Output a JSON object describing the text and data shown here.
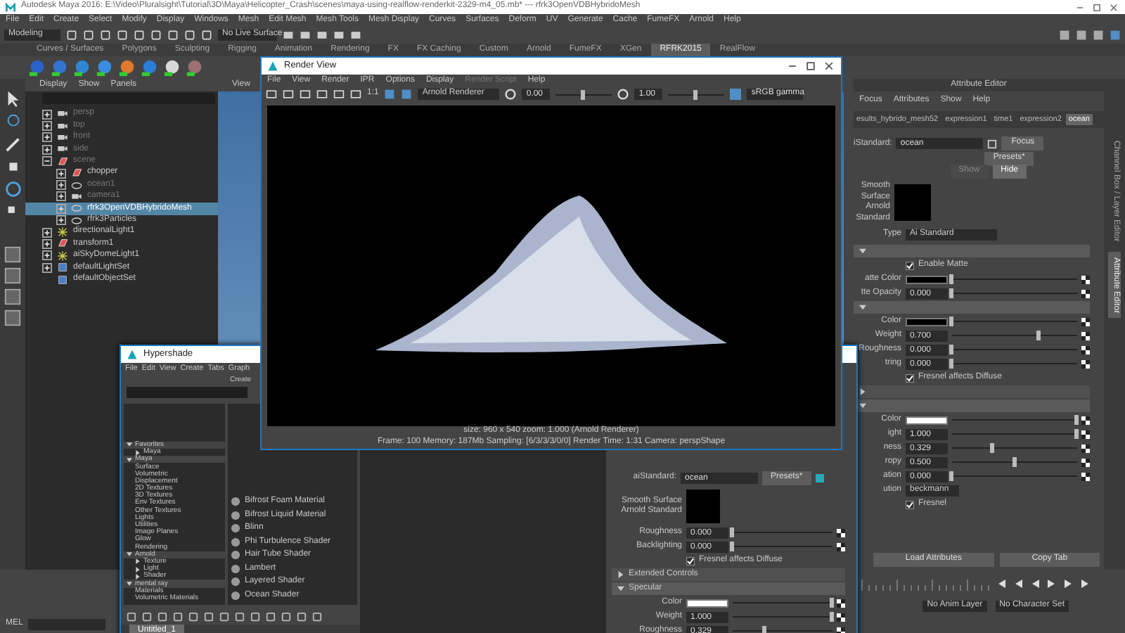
{
  "window": {
    "title": "Autodesk Maya 2016: E:\\Video\\Pluralsight\\Tutorial\\3D\\Maya\\Helicopter_Crash\\scenes\\maya-using-realflow-renderkit-2329-m4_05.mb*  ---  rfrk3OpenVDBHybridoMesh"
  },
  "menubar": [
    "File",
    "Edit",
    "Create",
    "Select",
    "Modify",
    "Display",
    "Windows",
    "Mesh",
    "Edit Mesh",
    "Mesh Tools",
    "Mesh Display",
    "Curves",
    "Surfaces",
    "Deform",
    "UV",
    "Generate",
    "Cache",
    "FumeFX",
    "Arnold",
    "Help"
  ],
  "status_line": {
    "mode": "Modeling",
    "live_surface": "No Live Surface"
  },
  "shelf_tabs": [
    {
      "label": "Curves / Surfaces",
      "selected": false
    },
    {
      "label": "Polygons",
      "selected": false
    },
    {
      "label": "Sculpting",
      "selected": false
    },
    {
      "label": "Rigging",
      "selected": false
    },
    {
      "label": "Animation",
      "selected": false
    },
    {
      "label": "Rendering",
      "selected": false
    },
    {
      "label": "FX",
      "selected": false
    },
    {
      "label": "FX Caching",
      "selected": false
    },
    {
      "label": "Custom",
      "selected": false
    },
    {
      "label": "Arnold",
      "selected": false
    },
    {
      "label": "FumeFX",
      "selected": false
    },
    {
      "label": "XGen",
      "selected": false
    },
    {
      "label": "RFRK2015",
      "selected": true
    },
    {
      "label": "RealFlow",
      "selected": false
    }
  ],
  "outliner": {
    "menu": [
      "Display",
      "Show",
      "Panels"
    ],
    "items": [
      {
        "label": "persp",
        "kind": "camera",
        "hidden": true,
        "selected": false,
        "expanded": false
      },
      {
        "label": "top",
        "kind": "camera",
        "hidden": true,
        "selected": false,
        "expanded": false
      },
      {
        "label": "front",
        "kind": "camera",
        "hidden": true,
        "selected": false,
        "expanded": false
      },
      {
        "label": "side",
        "kind": "camera",
        "hidden": true,
        "selected": false,
        "expanded": false
      },
      {
        "label": "scene",
        "kind": "group",
        "hidden": true,
        "selected": false,
        "expanded": true,
        "children": [
          {
            "label": "chopper",
            "kind": "group",
            "hidden": false,
            "selected": false,
            "expanded": false
          },
          {
            "label": "ocean1",
            "kind": "mesh",
            "hidden": true,
            "selected": false,
            "expanded": false
          },
          {
            "label": "camera1",
            "kind": "camera",
            "hidden": true,
            "selected": false,
            "expanded": false
          },
          {
            "label": "rfrk3OpenVDBHybridoMesh",
            "kind": "mesh",
            "hidden": false,
            "selected": true,
            "expanded": false
          },
          {
            "label": "rfrk3Particles",
            "kind": "mesh",
            "hidden": false,
            "selected": false,
            "expanded": false
          }
        ]
      },
      {
        "label": "directionalLight1",
        "kind": "light",
        "hidden": false,
        "selected": false,
        "expanded": false
      },
      {
        "label": "transform1",
        "kind": "group",
        "hidden": false,
        "selected": false,
        "expanded": false
      },
      {
        "label": "aiSkyDomeLight1",
        "kind": "light",
        "hidden": false,
        "selected": false,
        "expanded": false
      },
      {
        "label": "defaultLightSet",
        "kind": "set",
        "hidden": false,
        "selected": false,
        "expanded": false
      },
      {
        "label": "defaultObjectSet",
        "kind": "set",
        "hidden": false,
        "selected": false
      }
    ]
  },
  "viewport": {
    "menu": [
      "View"
    ]
  },
  "render_view": {
    "title": "Render View",
    "menu": [
      {
        "label": "File",
        "disabled": false
      },
      {
        "label": "View",
        "disabled": false
      },
      {
        "label": "Render",
        "disabled": false
      },
      {
        "label": "IPR",
        "disabled": false
      },
      {
        "label": "Options",
        "disabled": false
      },
      {
        "label": "Display",
        "disabled": false
      },
      {
        "label": "Render Script",
        "disabled": true
      },
      {
        "label": "Help",
        "disabled": false
      }
    ],
    "ratio": "1:1",
    "renderer": "Arnold Renderer",
    "exposure": {
      "value": "0.00",
      "level": 0.5
    },
    "gamma": {
      "value": "1.00",
      "level": 0.5
    },
    "color_space": "sRGB gamma",
    "info": "size: 960 x 540 zoom: 1.000     (Arnold Renderer)",
    "stats": "Frame: 100    Memory: 187Mb    Sampling: [6/3/3/3/0/0]    Render Time: 1:31    Camera: perspShape"
  },
  "hypershade": {
    "title": "Hypershade",
    "menu": [
      "File",
      "Edit",
      "View",
      "Create",
      "Tabs",
      "Graph"
    ],
    "browser_title": "Create",
    "categories": [
      {
        "label": "Favorites",
        "expanded": true,
        "children": [
          {
            "label": "Maya",
            "expanded": false
          }
        ]
      },
      {
        "label": "Maya",
        "expanded": true,
        "children": [
          {
            "label": "Surface"
          },
          {
            "label": "Volumetric"
          },
          {
            "label": "Displacement"
          },
          {
            "label": "2D Textures"
          },
          {
            "label": "3D Textures"
          },
          {
            "label": "Env Textures"
          },
          {
            "label": "Other Textures"
          },
          {
            "label": "Lights"
          },
          {
            "label": "Utilities"
          },
          {
            "label": "Image Planes"
          },
          {
            "label": "Glow"
          },
          {
            "label": "Rendering"
          }
        ]
      },
      {
        "label": "Arnold",
        "expanded": true,
        "children": [
          {
            "label": "Texture",
            "expanded": false
          },
          {
            "label": "Light",
            "expanded": false
          },
          {
            "label": "Shader",
            "expanded": false
          }
        ]
      },
      {
        "label": "mental ray",
        "expanded": true,
        "children": [
          {
            "label": "Materials"
          },
          {
            "label": "Volumetric Materials"
          }
        ]
      }
    ],
    "materials": [
      "Bifrost Foam Material",
      "Bifrost Liquid Material",
      "Blinn",
      "Phi Turbulence Shader",
      "Hair Tube Shader",
      "Lambert",
      "Layered Shader",
      "Ocean Shader"
    ],
    "tabs": [
      {
        "label": "Untitled_1",
        "selected": true
      }
    ],
    "properties": [
      {
        "kind": "header",
        "label": "aiStandard:",
        "value": "ocean",
        "button": "Presets*"
      },
      {
        "kind": "swatch",
        "label": "Smooth Surface Arnold Standard",
        "color": "#000000"
      },
      {
        "kind": "slider",
        "label": "Roughness",
        "value": "0.000",
        "level": 0
      },
      {
        "kind": "slider",
        "label": "Backlighting",
        "value": "0.000",
        "level": 0
      },
      {
        "kind": "checkbox",
        "label": "Fresnel affects Diffuse",
        "checked": true
      },
      {
        "kind": "section",
        "label": "Extended Controls",
        "expanded": false
      },
      {
        "kind": "section",
        "label": "Specular",
        "expanded": true
      },
      {
        "kind": "color",
        "label": "Color",
        "color": "#ffffff",
        "level": 1
      },
      {
        "kind": "slider",
        "label": "Weight",
        "value": "1.000",
        "level": 1
      },
      {
        "kind": "slider",
        "label": "Roughness",
        "value": "0.329",
        "level": 0.33
      }
    ]
  },
  "attribute_editor": {
    "title": "Attribute Editor",
    "menu": [
      "Focus",
      "Attributes",
      "Show",
      "Help"
    ],
    "tabs": [
      {
        "label": "esults_hybrido_mesh52",
        "selected": false
      },
      {
        "label": "expression1",
        "selected": false
      },
      {
        "label": "time1",
        "selected": false
      },
      {
        "label": "expression2",
        "selected": false
      },
      {
        "label": "ocean",
        "selected": true
      }
    ],
    "name_label": "iStandard:",
    "name_value": "ocean",
    "focus_button": "Focus",
    "presets_button": "Presets*",
    "show_hide": [
      {
        "label": "Show",
        "selected": false
      },
      {
        "label": "Hide",
        "selected": true
      }
    ],
    "swatch_label": "Smooth Surface Arnold Standard",
    "type_label": "Type",
    "type_value": "Ai Standard",
    "rows": [
      {
        "kind": "section",
        "expanded": true
      },
      {
        "kind": "checkbox",
        "label": "Enable Matte",
        "checked": true
      },
      {
        "kind": "color",
        "label": "atte Color",
        "color": "#000000",
        "level": 0
      },
      {
        "kind": "slider",
        "label": "tte Opacity",
        "value": "0.000",
        "level": 0
      },
      {
        "kind": "section",
        "expanded": true
      },
      {
        "kind": "color",
        "label": "Color",
        "color": "#000000",
        "level": 0
      },
      {
        "kind": "slider",
        "label": "Weight",
        "value": "0.700",
        "level": 0.7
      },
      {
        "kind": "slider",
        "label": "Roughness",
        "value": "0.000",
        "level": 0
      },
      {
        "kind": "slider",
        "label": "tring",
        "value": "0.000",
        "level": 0
      },
      {
        "kind": "checkbox",
        "label": "Fresnel affects Diffuse",
        "checked": true
      },
      {
        "kind": "section",
        "expanded": false
      },
      {
        "kind": "section",
        "expanded": true
      },
      {
        "kind": "color",
        "label": "Color",
        "color": "#ffffff",
        "level": 1
      },
      {
        "kind": "slider",
        "label": "ight",
        "value": "1.000",
        "level": 1
      },
      {
        "kind": "slider",
        "label": "ness",
        "value": "0.329",
        "level": 0.33
      },
      {
        "kind": "slider",
        "label": "ropy",
        "value": "0.500",
        "level": 0.5
      },
      {
        "kind": "slider",
        "label": "ation",
        "value": "0.000",
        "level": 0
      },
      {
        "kind": "dropdown",
        "label": "ution",
        "value": "beckmann"
      },
      {
        "kind": "checkbox",
        "label": "Fresnel",
        "checked": true
      }
    ],
    "buttons": [
      "Load Attributes",
      "Copy Tab"
    ]
  },
  "side_tabs": [
    {
      "label": "Channel Box / Layer Editor",
      "selected": false
    },
    {
      "label": "Attribute Editor",
      "selected": true
    }
  ],
  "range_bar": {
    "anim_layer": "No Anim Layer",
    "character_set": "No Character Set"
  },
  "command_line": {
    "language": "MEL"
  }
}
